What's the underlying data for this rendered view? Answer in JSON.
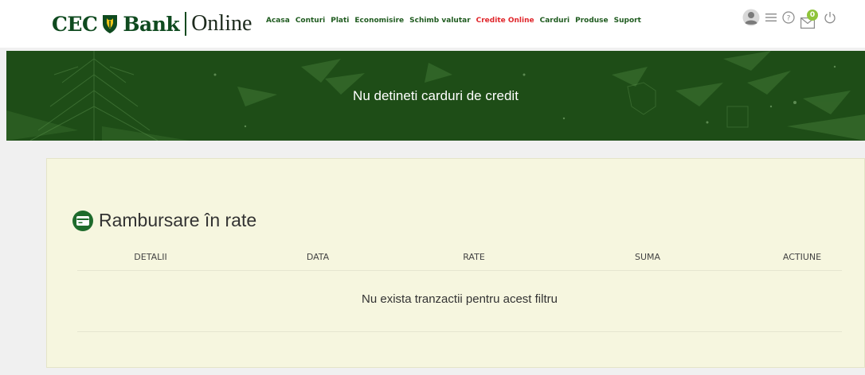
{
  "logo": {
    "cec": "CEC",
    "bank": "Bank",
    "online": "Online",
    "brand_color": "#0f4a1f"
  },
  "nav": {
    "items": [
      {
        "label": "Acasa",
        "active": false
      },
      {
        "label": "Conturi",
        "active": false
      },
      {
        "label": "Plati",
        "active": false
      },
      {
        "label": "Economisire",
        "active": false
      },
      {
        "label": "Schimb valutar",
        "active": false
      },
      {
        "label": "Credite Online",
        "active": true
      },
      {
        "label": "Carduri",
        "active": false
      },
      {
        "label": "Produse",
        "active": false
      },
      {
        "label": "Suport",
        "active": false
      }
    ],
    "color": "#1f5b1f",
    "active_color": "#e0262b"
  },
  "header_icons": {
    "user": "user-avatar-icon",
    "menu": "hamburger-menu-icon",
    "help": "help-circle-icon",
    "mail": "mail-icon",
    "mail_badge": "0",
    "power": "power-icon",
    "badge_color": "#8fc43a"
  },
  "banner": {
    "message": "Nu detineti carduri de credit",
    "color": "#1e4d17"
  },
  "installments": {
    "title": "Rambursare în rate",
    "icon": "credit-card-icon",
    "columns": [
      "DETALII",
      "DATA",
      "RATE",
      "SUMA",
      "ACTIUNE"
    ],
    "empty_message": "Nu exista tranzactii pentru acest filtru",
    "card_bg": "#f6f6df"
  }
}
